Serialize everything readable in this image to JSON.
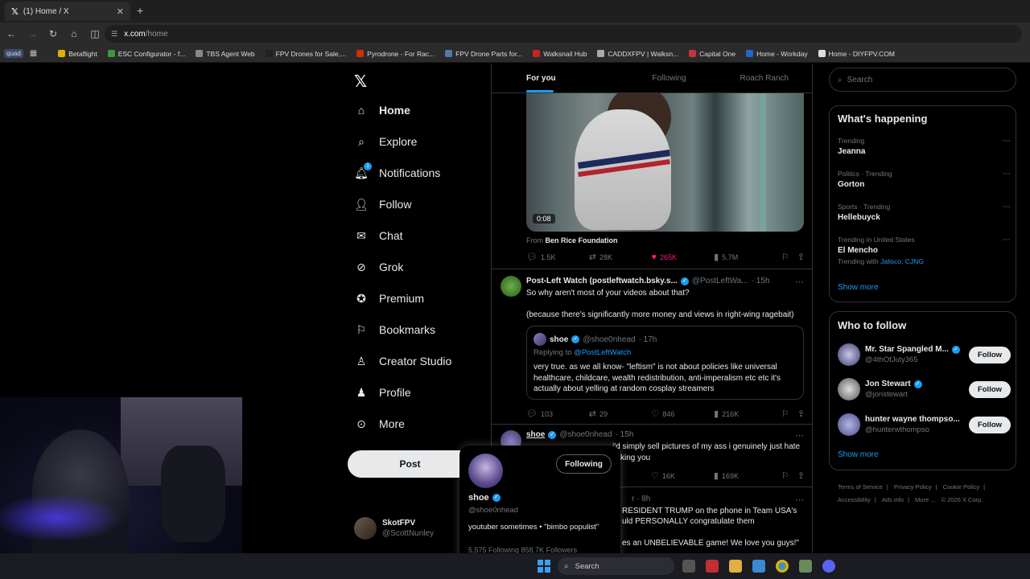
{
  "browser": {
    "tab_title": "(1) Home / X",
    "url_host": "x.com",
    "url_path": "/home",
    "profile_chip": "quad",
    "bookmarks": [
      {
        "label": "Betaflight",
        "color": "#e0b000"
      },
      {
        "label": "ESC Configurator - f...",
        "color": "#3a9a3a"
      },
      {
        "label": "TBS Agent Web",
        "color": "#888888"
      },
      {
        "label": "FPV Drones for Sale,...",
        "color": "#222222"
      },
      {
        "label": "Pyrodrone - For Rac...",
        "color": "#cc3300"
      },
      {
        "label": "FPV Drone Parts for...",
        "color": "#5577aa"
      },
      {
        "label": "Walksnail Hub",
        "color": "#cc2222"
      },
      {
        "label": "CADDXFPV | Walksn...",
        "color": "#aaaaaa"
      },
      {
        "label": "Capital One",
        "color": "#c4343a"
      },
      {
        "label": "Home - Workday",
        "color": "#2266cc"
      },
      {
        "label": "Home - DIYFPV.COM",
        "color": "#dddddd"
      }
    ]
  },
  "nav": {
    "items": [
      {
        "label": "Home",
        "icon": "home-icon"
      },
      {
        "label": "Explore",
        "icon": "search-icon"
      },
      {
        "label": "Notifications",
        "icon": "bell-icon",
        "badge": "1"
      },
      {
        "label": "Follow",
        "icon": "add-person-icon"
      },
      {
        "label": "Chat",
        "icon": "mail-icon"
      },
      {
        "label": "Grok",
        "icon": "grok-icon"
      },
      {
        "label": "Premium",
        "icon": "verified-badge-icon"
      },
      {
        "label": "Bookmarks",
        "icon": "bookmark-icon"
      },
      {
        "label": "Creator Studio",
        "icon": "creator-icon"
      },
      {
        "label": "Profile",
        "icon": "person-icon"
      },
      {
        "label": "More",
        "icon": "more-circle-icon"
      }
    ],
    "post_button": "Post",
    "account": {
      "name": "SkotFPV",
      "handle": "@ScottNunley"
    }
  },
  "feed": {
    "tabs": [
      "For you",
      "Following",
      "Roach Ranch"
    ],
    "video": {
      "time": "0:08",
      "from_label": "From",
      "from_source": "Ben Rice Foundation",
      "stats": {
        "replies": "1.5K",
        "reposts": "28K",
        "likes": "265K",
        "views": "5.7M"
      }
    },
    "tweet1": {
      "name": "Post-Left Watch (postleftwatch.bsky.s...",
      "handle": "@PostLeftWa...",
      "time": "· 15h",
      "text1": "So why aren't most of your videos about that?",
      "text2": "(because there's significantly more money and views in right-wing ragebait)",
      "quote": {
        "name": "shoe",
        "handle": "@shoe0nhead",
        "time": "· 17h",
        "replying_label": "Replying to",
        "replying_to": "@PostLeftWatch",
        "text": "very true. as we all know- \"leftism\" is not about policies like universal healthcare, childcare, wealth redistribution, anti-imperalism etc etc it's actually about yelling at random cosplay streamers"
      },
      "stats": {
        "replies": "103",
        "reposts": "29",
        "likes": "846",
        "views": "216K"
      }
    },
    "tweet2": {
      "name": "shoe",
      "handle": "@shoe0nhead",
      "time": "· 15h",
      "text_partial_1": "i'd simply sell pictures of my ass i genuinely just hate",
      "text_partial_2": "king you",
      "stats": {
        "likes": "16K",
        "views": "169K"
      }
    },
    "tweet3": {
      "time": "r · 8h",
      "text_partial_1": "RESIDENT TRUMP on the phone in Team USA's",
      "text_partial_2": "uld PERSONALLY congratulate them",
      "text_partial_3": "es an UNBELIEVABLE game! We love you guys!\""
    }
  },
  "hovercard": {
    "follow_state": "Following",
    "name": "shoe",
    "handle": "@shoe0nhead",
    "bio": "youtuber sometimes • \"bimbo populist\"",
    "stats_partial": "5,575 Following   858.7K Followers"
  },
  "sidebar": {
    "search_placeholder": "Search",
    "happening_title": "What's happening",
    "trends": [
      {
        "context": "Trending",
        "name": "Jeanna",
        "with": ""
      },
      {
        "context": "Politics · Trending",
        "name": "Gorton",
        "with": ""
      },
      {
        "context": "Sports · Trending",
        "name": "Hellebuyck",
        "with": ""
      },
      {
        "context": "Trending in United States",
        "name": "El Mencho",
        "with_label": "Trending with",
        "with": "Jalisco, CJNG"
      }
    ],
    "show_more": "Show more",
    "who_to_follow_title": "Who to follow",
    "who_to_follow": [
      {
        "name": "Mr. Star Spangled M...",
        "handle": "@4thOfJuly365",
        "verified": true,
        "button": "Follow"
      },
      {
        "name": "Jon Stewart",
        "handle": "@jonstewart",
        "verified": true,
        "button": "Follow"
      },
      {
        "name": "hunter wayne thompso...",
        "handle": "@hunterwthompso",
        "verified": false,
        "button": "Follow"
      }
    ],
    "footer": [
      "Terms of Service",
      "Privacy Policy",
      "Cookie Policy",
      "Accessibility",
      "Ads info",
      "More ...",
      "© 2026 X Corp."
    ]
  },
  "taskbar": {
    "search_placeholder": "Search"
  },
  "colors": {
    "accent": "#1d9bf0",
    "like": "#f91880",
    "background": "#000000"
  }
}
